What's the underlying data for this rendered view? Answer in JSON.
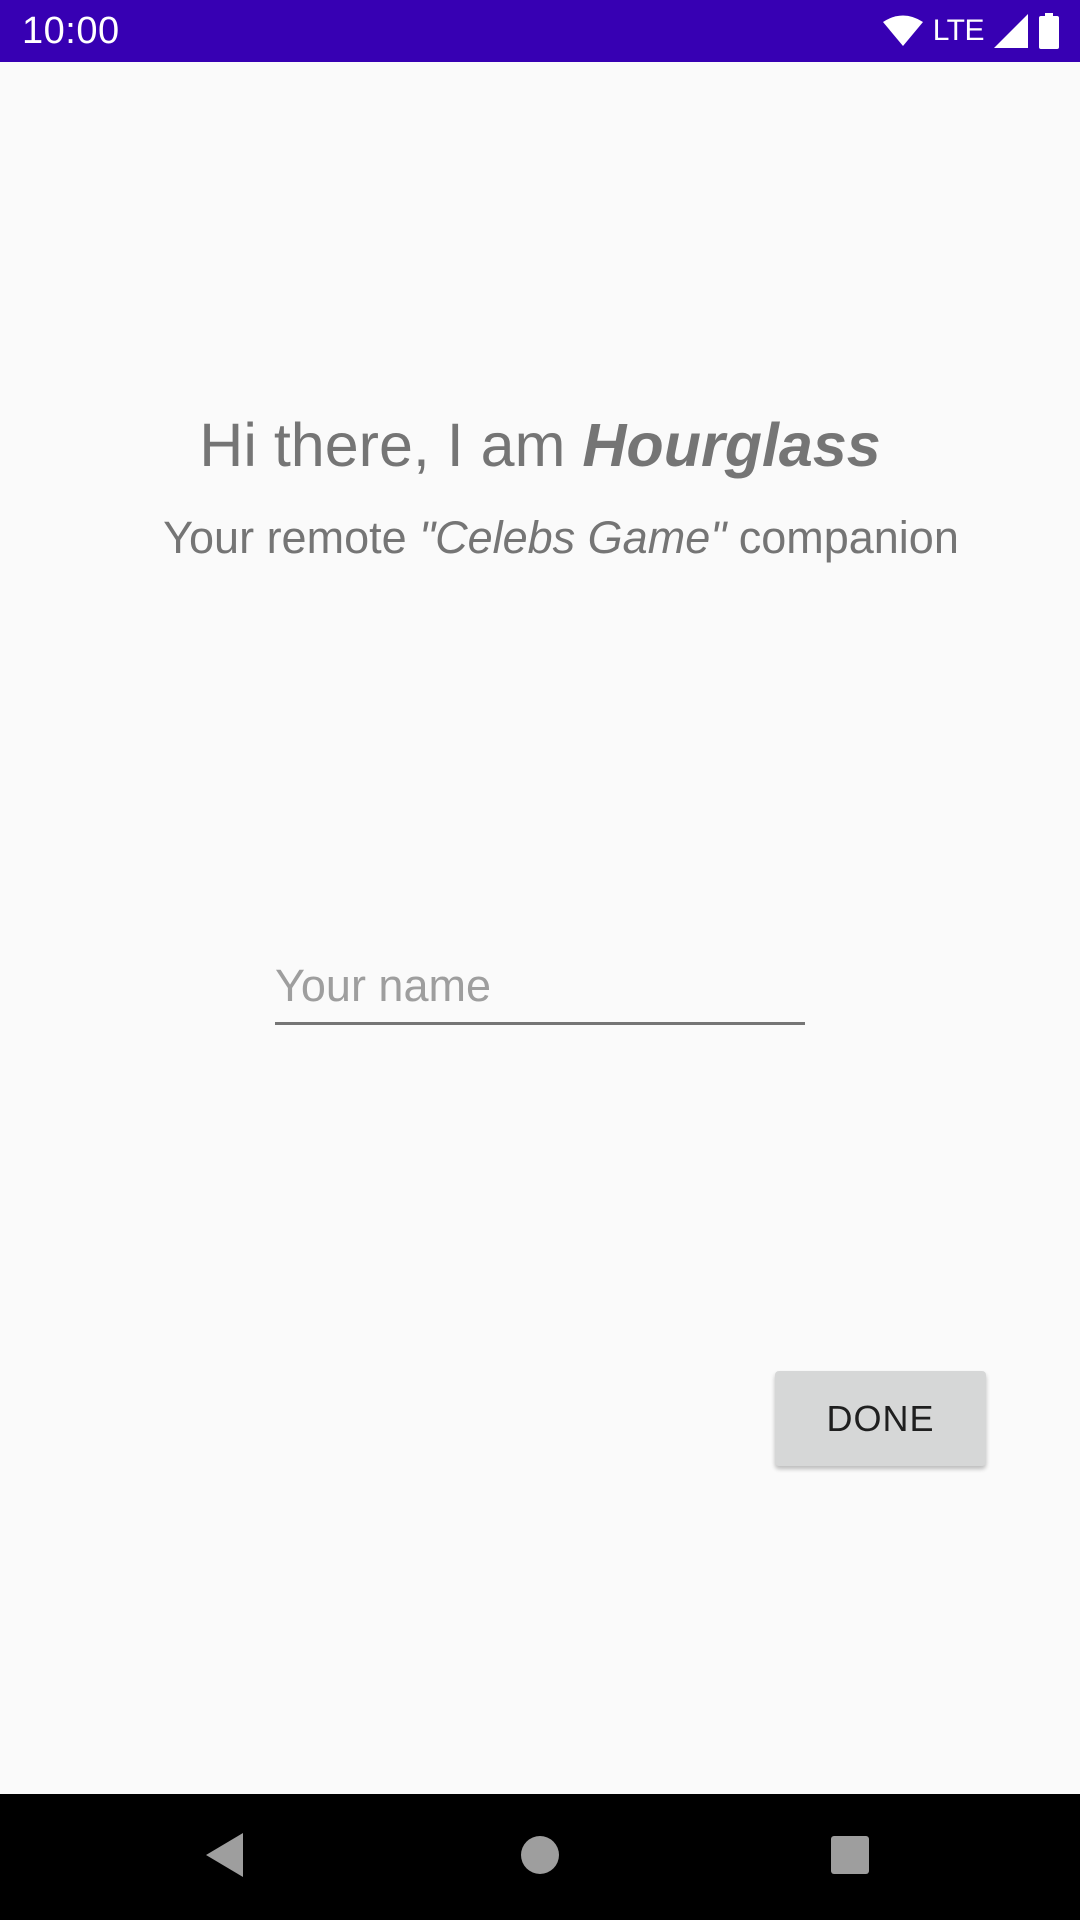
{
  "status_bar": {
    "time": "10:00",
    "network_label": "LTE",
    "background_color": "#3700b3",
    "icons": [
      "wifi-icon",
      "cell-signal-icon",
      "battery-icon"
    ]
  },
  "greeting": {
    "prefix": "Hi there, I am ",
    "app_name": "Hourglass"
  },
  "subtitle": {
    "prefix": "Your remote ",
    "game_name": "\"Celebs Game\"",
    "suffix": " companion"
  },
  "name_input": {
    "placeholder": "Your name",
    "value": ""
  },
  "done_button": {
    "label": "DONE"
  },
  "nav_bar": {
    "icons": [
      "back-icon",
      "home-icon",
      "recents-icon"
    ]
  }
}
